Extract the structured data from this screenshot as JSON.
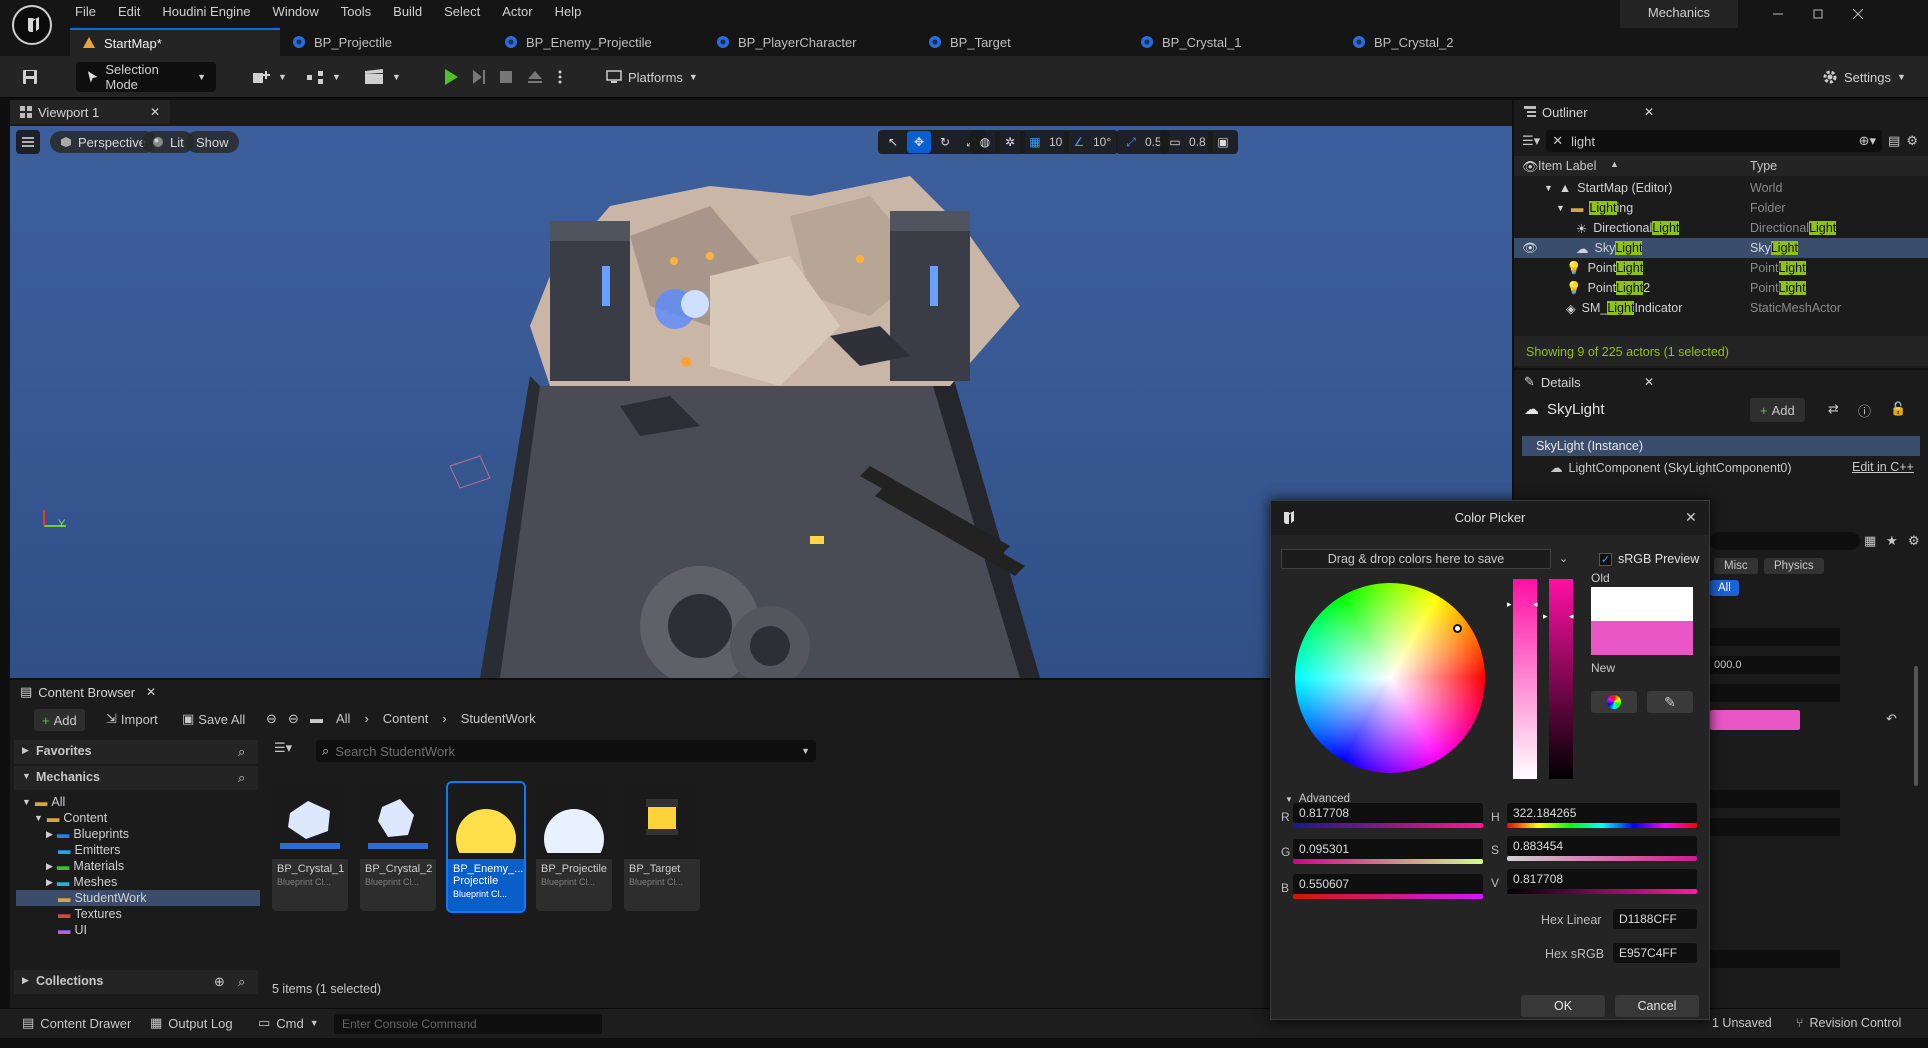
{
  "menu": [
    "File",
    "Edit",
    "Houdini Engine",
    "Window",
    "Tools",
    "Build",
    "Select",
    "Actor",
    "Help"
  ],
  "project_name": "Mechanics",
  "tabs": [
    {
      "label": "StartMap*"
    },
    {
      "label": "BP_Projectile"
    },
    {
      "label": "BP_Enemy_Projectile"
    },
    {
      "label": "BP_PlayerCharacter"
    },
    {
      "label": "BP_Target"
    },
    {
      "label": "BP_Crystal_1"
    },
    {
      "label": "BP_Crystal_2"
    }
  ],
  "toolbar": {
    "selection_mode": "Selection Mode",
    "platforms": "Platforms",
    "settings": "Settings"
  },
  "viewport": {
    "tab": "Viewport 1",
    "perspective": "Perspective",
    "lit": "Lit",
    "show": "Show",
    "grid_snap": "10",
    "rot_snap": "10°",
    "scale_snap": "0.5",
    "cam_speed": "0.8",
    "axis_y": "Y"
  },
  "outliner": {
    "title": "Outliner",
    "search": "light",
    "col_label": "Item Label",
    "col_type": "Type",
    "rows": [
      {
        "pre": "StartMap (Editor)",
        "hl": "",
        "post": "",
        "type_pre": "World",
        "type_hl": "",
        "type_post": ""
      },
      {
        "pre": "",
        "hl": "Light",
        "post": "ing",
        "type_pre": "Folder",
        "type_hl": "",
        "type_post": ""
      },
      {
        "pre": "Directional",
        "hl": "Light",
        "post": "",
        "type_pre": "Directional",
        "type_hl": "Light",
        "type_post": ""
      },
      {
        "pre": "Sky",
        "hl": "Light",
        "post": "",
        "type_pre": "Sky",
        "type_hl": "Light",
        "type_post": ""
      },
      {
        "pre": "Point",
        "hl": "Light",
        "post": "",
        "type_pre": "Point",
        "type_hl": "Light",
        "type_post": ""
      },
      {
        "pre": "Point",
        "hl": "Light",
        "post": "2",
        "type_pre": "Point",
        "type_hl": "Light",
        "type_post": ""
      },
      {
        "pre": "SM_",
        "hl": "Light",
        "post": "Indicator",
        "type_pre": "StaticMeshActor",
        "type_hl": "",
        "type_post": ""
      }
    ],
    "status": "Showing 9 of 225 actors (1 selected)"
  },
  "details": {
    "title": "Details",
    "actor": "SkyLight",
    "add": "Add",
    "instance": "SkyLight (Instance)",
    "component": "LightComponent (SkyLightComponent0)",
    "edit_cpp": "Edit in C++",
    "misc": "Misc",
    "physics": "Physics",
    "all": "All",
    "value": "000.0"
  },
  "content_browser": {
    "title": "Content Browser",
    "add": "Add",
    "import": "Import",
    "save_all": "Save All",
    "path": [
      "All",
      "Content",
      "StudentWork"
    ],
    "favorites": "Favorites",
    "mechanics": "Mechanics",
    "tree": [
      "All",
      "Content",
      "Blueprints",
      "Emitters",
      "Materials",
      "Meshes",
      "StudentWork",
      "Textures",
      "UI"
    ],
    "collections": "Collections",
    "search_placeholder": "Search StudentWork",
    "assets": [
      {
        "name": "BP_Crystal_1",
        "cls": "Blueprint Cl..."
      },
      {
        "name": "BP_Crystal_2",
        "cls": "Blueprint Cl..."
      },
      {
        "name": "BP_Enemy_...",
        "name2": "Projectile",
        "cls": "Blueprint Cl..."
      },
      {
        "name": "BP_Projectile",
        "cls": "Blueprint Cl..."
      },
      {
        "name": "BP_Target",
        "cls": "Blueprint Cl..."
      }
    ],
    "count": "5 items (1 selected)"
  },
  "statusbar": {
    "drawer": "Content Drawer",
    "output": "Output Log",
    "cmd": "Cmd",
    "console_placeholder": "Enter Console Command",
    "unsaved": "1 Unsaved",
    "revision": "Revision Control"
  },
  "color_picker": {
    "title": "Color Picker",
    "drag_drop": "Drag & drop colors here to save",
    "srgb": "sRGB Preview",
    "old": "Old",
    "new": "New",
    "advanced": "Advanced",
    "r_label": "R",
    "r": "0.817708",
    "g_label": "G",
    "g": "0.095301",
    "b_label": "B",
    "b": "0.550607",
    "h_label": "H",
    "h": "322.184265",
    "s_label": "S",
    "s": "0.883454",
    "v_label": "V",
    "v": "0.817708",
    "hex_linear_label": "Hex Linear",
    "hex_linear": "D1188CFF",
    "hex_srgb_label": "Hex sRGB",
    "hex_srgb": "E957C4FF",
    "ok": "OK",
    "cancel": "Cancel",
    "new_color": "#E957C4",
    "old_color": "#FFFFFF"
  }
}
